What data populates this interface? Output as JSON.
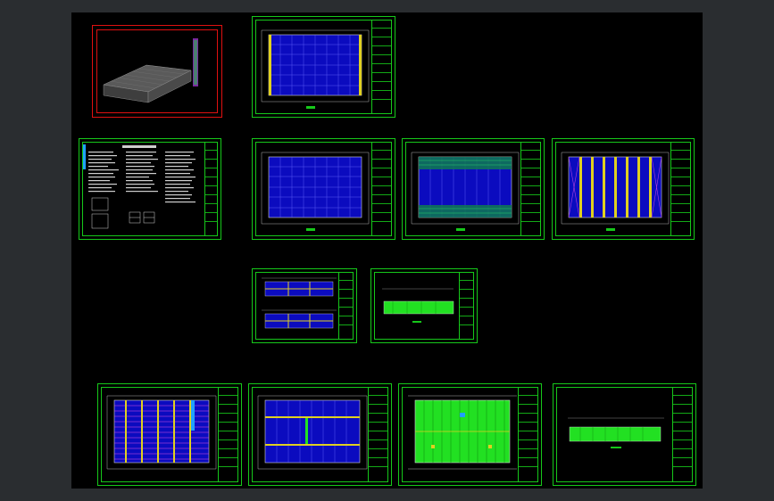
{
  "viewer": {
    "background": "#2a2d30",
    "canvas_color": "#000000",
    "line_color": "#16c81a"
  },
  "sheets": [
    {
      "id": "3d-view",
      "kind": "3d"
    },
    {
      "id": "roof-plan-1",
      "kind": "plan"
    },
    {
      "id": "design-notes",
      "kind": "notes"
    },
    {
      "id": "column-plan",
      "kind": "plan"
    },
    {
      "id": "purlin-plan",
      "kind": "plan"
    },
    {
      "id": "bracing-plan",
      "kind": "bracing"
    },
    {
      "id": "elevations",
      "kind": "elevations"
    },
    {
      "id": "section",
      "kind": "section"
    },
    {
      "id": "wall-frame-plan",
      "kind": "plan"
    },
    {
      "id": "foundation-plan",
      "kind": "plan"
    },
    {
      "id": "roof-panel-plan",
      "kind": "roof"
    },
    {
      "id": "side-elevation",
      "kind": "section"
    }
  ]
}
